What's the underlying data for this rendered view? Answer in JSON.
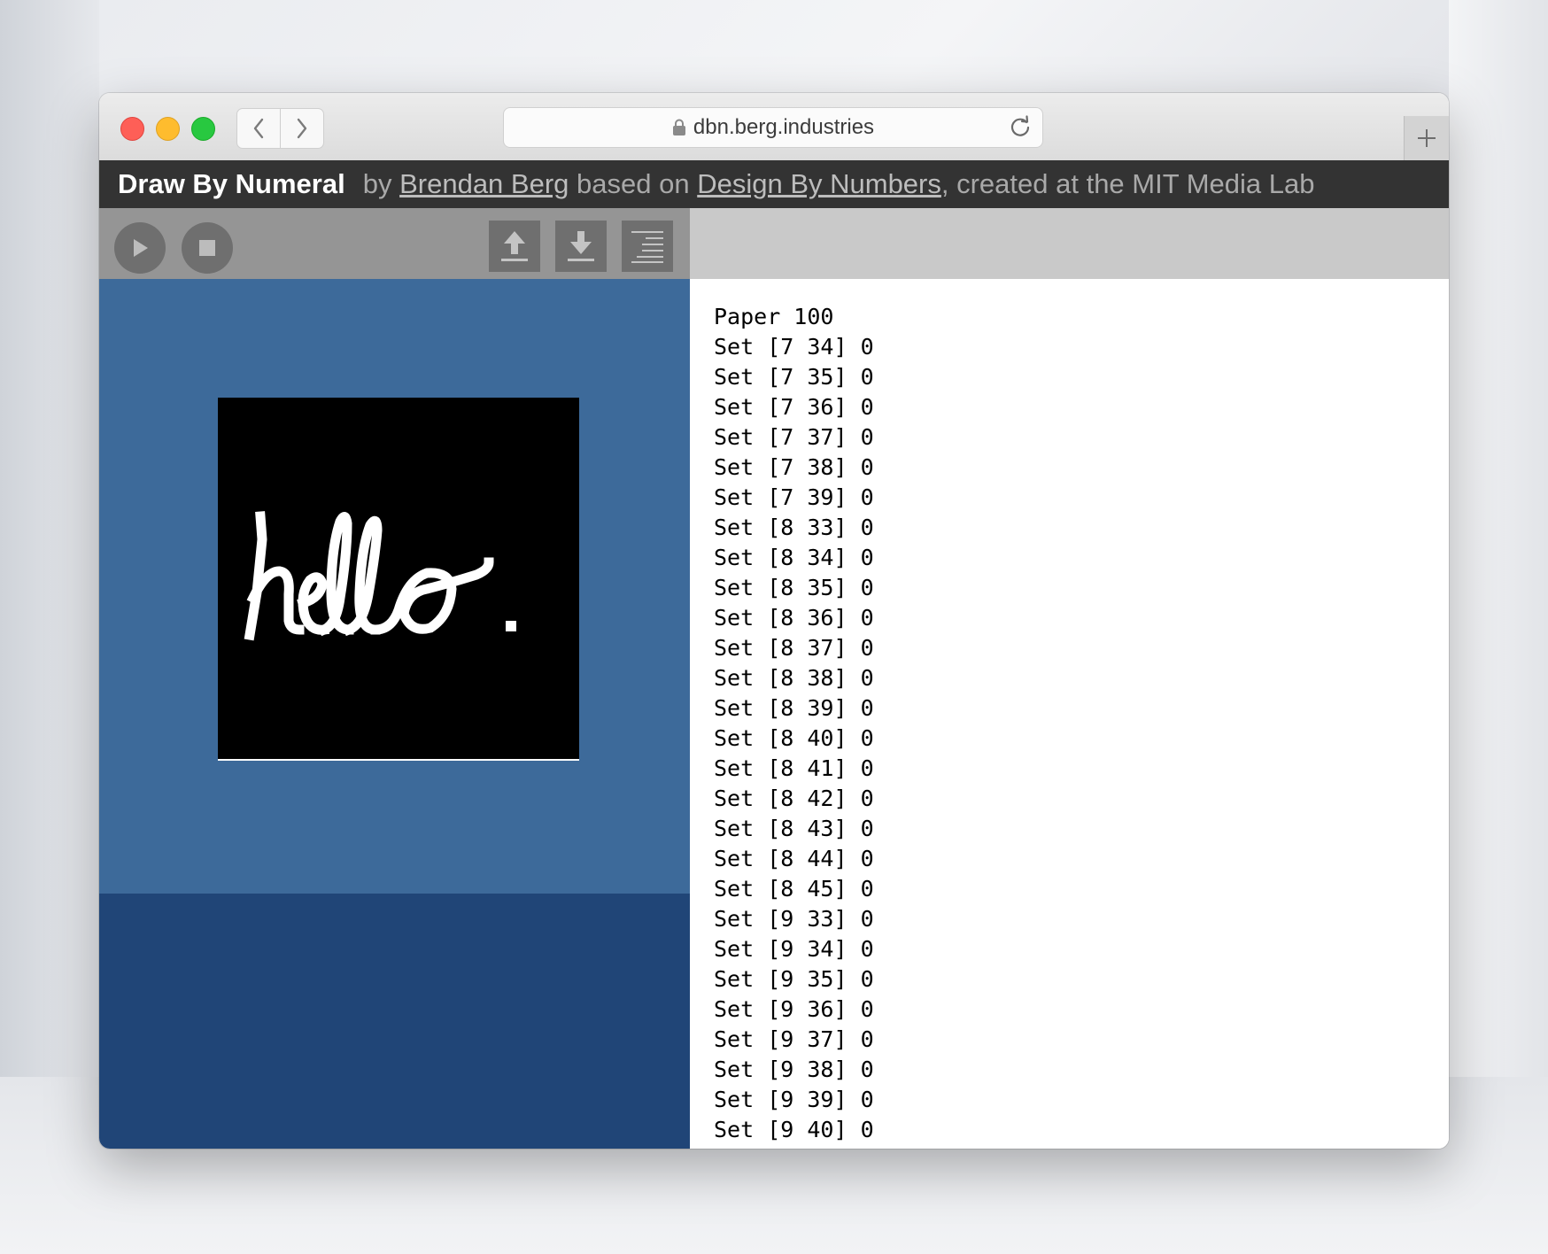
{
  "browser": {
    "url": "dbn.berg.industries"
  },
  "header": {
    "app_title": "Draw By Numeral",
    "by": "by",
    "author": "Brendan Berg",
    "based_on": "based on",
    "original": "Design By Numbers",
    "suffix": ", created at the MIT Media Lab"
  },
  "toolbar": {
    "icons": [
      "play-icon",
      "stop-icon",
      "upload-icon",
      "download-icon",
      "menu-lines-icon"
    ]
  },
  "canvas": {
    "drawing": "hello.",
    "ink_color": "#ffffff",
    "paper_color": "#000000"
  },
  "colors": {
    "stage": "#3d6a9a",
    "stage_lower": "#204577",
    "header_bg": "#333333"
  },
  "code": {
    "lines": [
      "Paper 100",
      "Set [7 34] 0",
      "Set [7 35] 0",
      "Set [7 36] 0",
      "Set [7 37] 0",
      "Set [7 38] 0",
      "Set [7 39] 0",
      "Set [8 33] 0",
      "Set [8 34] 0",
      "Set [8 35] 0",
      "Set [8 36] 0",
      "Set [8 37] 0",
      "Set [8 38] 0",
      "Set [8 39] 0",
      "Set [8 40] 0",
      "Set [8 41] 0",
      "Set [8 42] 0",
      "Set [8 43] 0",
      "Set [8 44] 0",
      "Set [8 45] 0",
      "Set [9 33] 0",
      "Set [9 34] 0",
      "Set [9 35] 0",
      "Set [9 36] 0",
      "Set [9 37] 0",
      "Set [9 38] 0",
      "Set [9 39] 0",
      "Set [9 40] 0"
    ]
  }
}
